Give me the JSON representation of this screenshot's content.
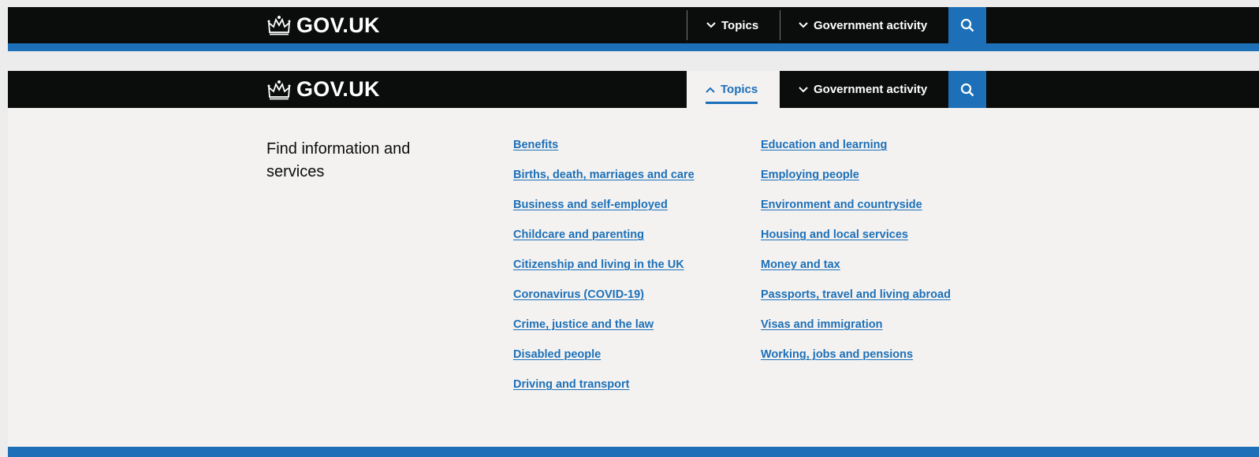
{
  "header": {
    "logo_text": "GOV.UK",
    "topics_label": "Topics",
    "gov_activity_label": "Government activity",
    "search_icon": "search-icon",
    "colors": {
      "header_bg": "#0b0c0c",
      "accent": "#1d70b8",
      "panel_bg": "#f3f2f1"
    }
  },
  "menu": {
    "heading": "Find information and services",
    "col1": [
      "Benefits",
      "Births, death, marriages and care",
      "Business and self-employed",
      "Childcare and parenting",
      "Citizenship and living in the UK",
      "Coronavirus (COVID-19)",
      "Crime, justice and the law",
      "Disabled people",
      "Driving and transport"
    ],
    "col2": [
      "Education and learning",
      "Employing people",
      "Environment and countryside",
      "Housing and local services",
      "Money and tax",
      "Passports, travel and living abroad",
      "Visas and immigration",
      "Working, jobs and pensions"
    ]
  }
}
